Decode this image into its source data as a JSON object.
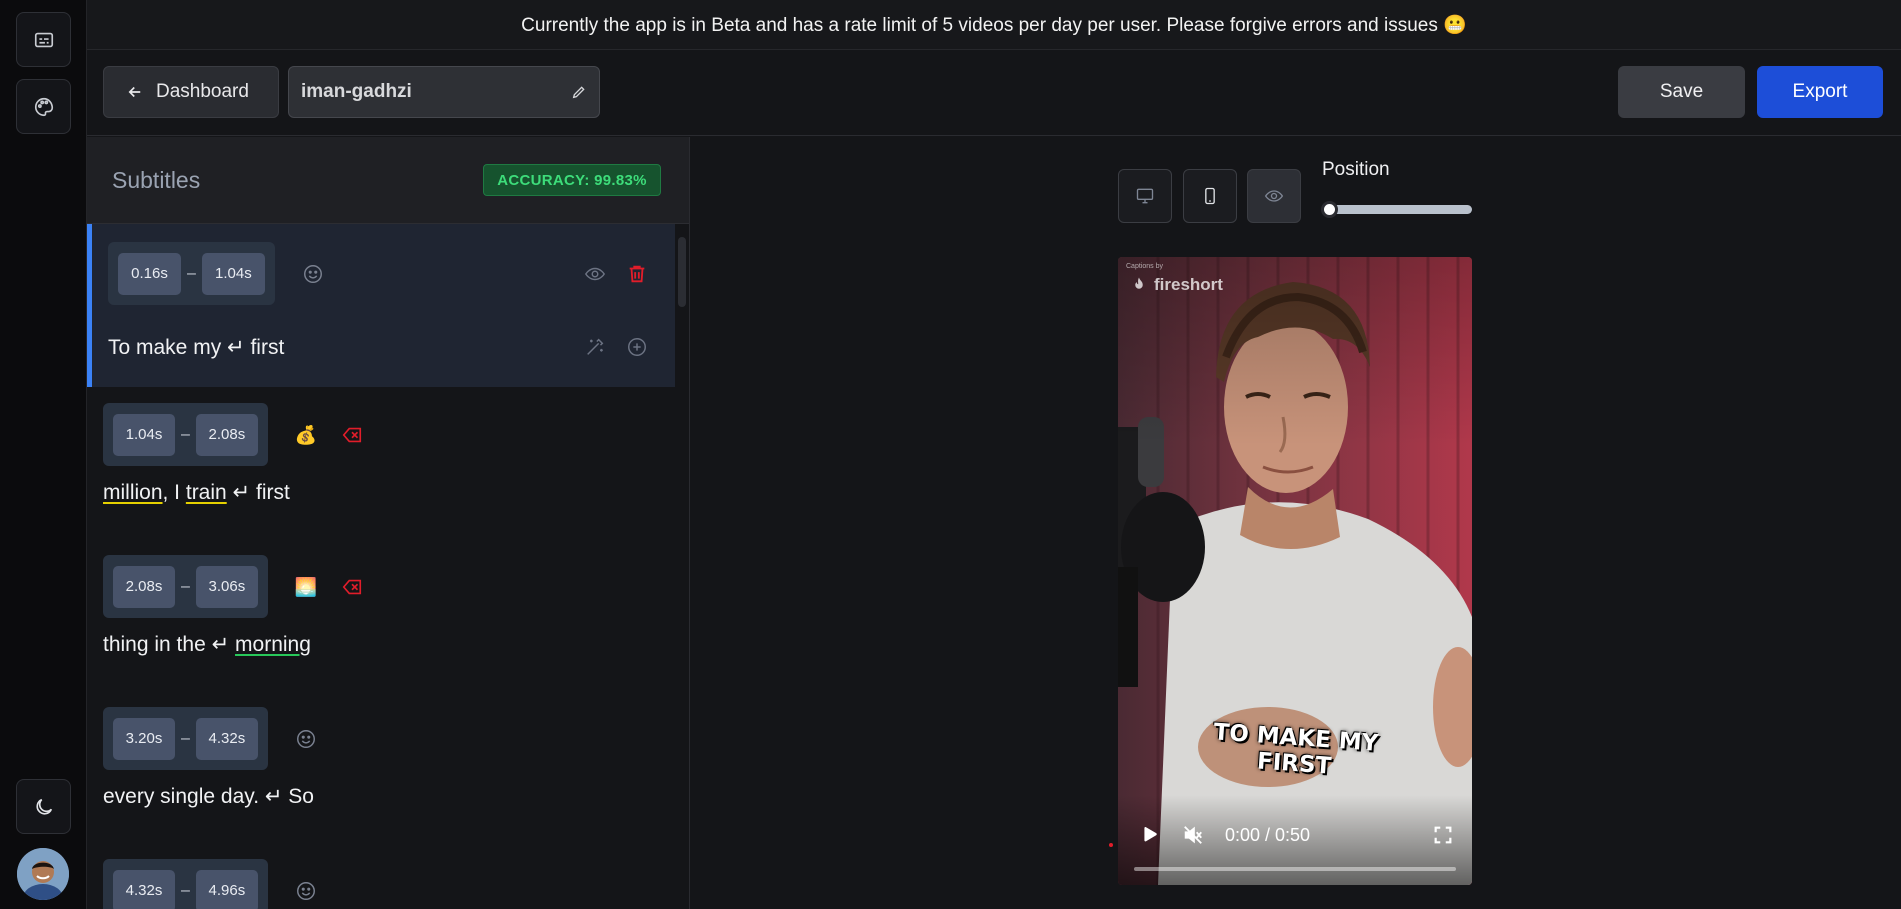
{
  "banner": {
    "text": "Currently the app is in Beta and has a rate limit of 5 videos per day per user. Please forgive errors and issues 😬"
  },
  "toolbar": {
    "back_label": "Dashboard",
    "project_name": "iman-gadhzi",
    "save_label": "Save",
    "export_label": "Export"
  },
  "subtitles": {
    "title": "Subtitles",
    "accuracy": "ACCURACY: 99.83%",
    "items": [
      {
        "start": "0.16s",
        "end": "1.04s",
        "emoji": "",
        "words": [
          "To make my ",
          "↵",
          " first"
        ]
      },
      {
        "start": "1.04s",
        "end": "2.08s",
        "emoji": "💰",
        "words": [
          "million",
          ", I ",
          "train",
          " ↵ first"
        ]
      },
      {
        "start": "2.08s",
        "end": "3.06s",
        "emoji": "🌅",
        "words": [
          "thing in the ",
          "↵ ",
          "morning"
        ]
      },
      {
        "start": "3.20s",
        "end": "4.32s",
        "emoji": "",
        "words": [
          "every single day. ",
          "↵",
          " So"
        ]
      },
      {
        "start": "4.32s",
        "end": "4.96s",
        "emoji": ""
      }
    ],
    "dash": "–"
  },
  "preview": {
    "position_label": "Position",
    "position_value": 0,
    "brand_small": "Captions by",
    "brand": "fireshort",
    "caption_line1": "TO MAKE MY",
    "caption_line2": "FIRST",
    "time": "0:00 / 0:50",
    "progress": 0
  },
  "colors": {
    "accent": "#1d4ed8",
    "active_border": "#3b82f6",
    "accuracy_bg": "#16532e",
    "accuracy_text": "#3ddc7a",
    "delete_red": "#e11d2a"
  }
}
